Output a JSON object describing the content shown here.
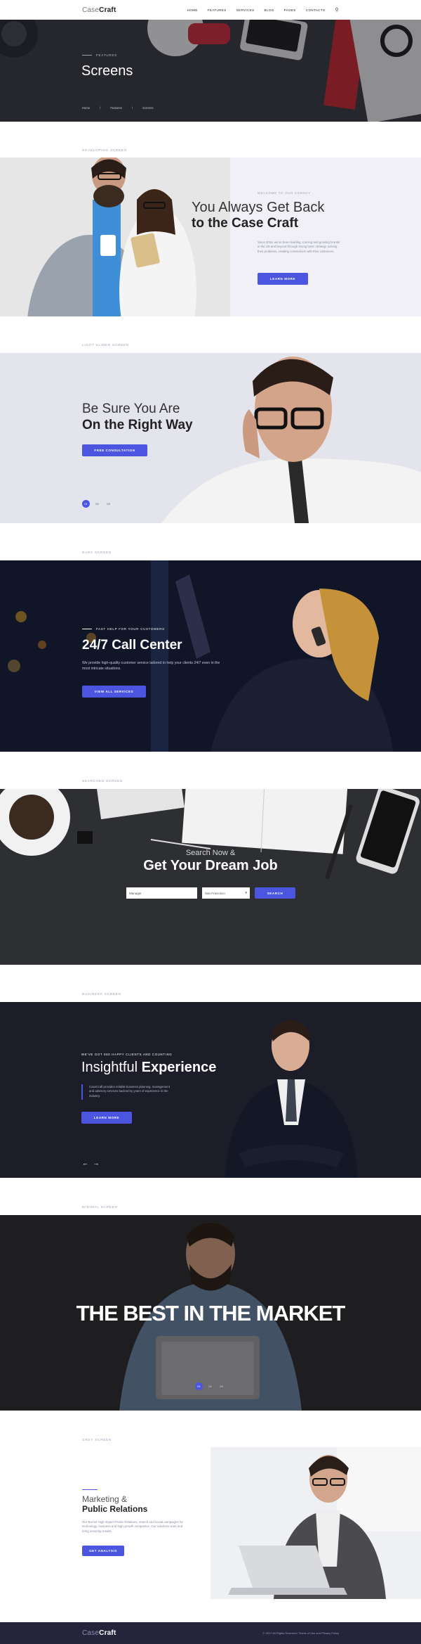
{
  "header": {
    "logo_light": "Case",
    "logo_bold": "Craft",
    "nav": [
      "Home",
      "Features",
      "Services",
      "Blog",
      "Pages",
      "Contacts"
    ]
  },
  "hero": {
    "kicker": "FEATURES",
    "title": "Screens",
    "breadcrumbs": [
      "Home",
      "Features",
      "Screens"
    ]
  },
  "s1": {
    "label": "DEVELOPING SCREEN",
    "kicker": "WELCOME TO OUR AGENCY",
    "title_light": "You Always Get Back",
    "title_bold": "to the Case Craft",
    "body": "Since 2016, we've been building, running and growing brands in the US and beyond through strong basic strategy, solving their problems, creating connections with their customers.",
    "button": "LEARN MORE"
  },
  "s2": {
    "label": "LIGHT SLIDER SCREEN",
    "title_light": "Be Sure You Are",
    "title_bold": "On the Right Way",
    "button": "FREE CONSULTATION",
    "dots": [
      "01",
      "02",
      "03"
    ]
  },
  "s3": {
    "label": "DARK SCREEN",
    "kicker": "FAST HELP FOR YOUR CUSTOMERS",
    "title": "24/7 Call Center",
    "body": "We provide high-quality customer service tailored to help your clients 24/7 even in the most intricate situations.",
    "button": "VIEW ALL SERVICES"
  },
  "s4": {
    "label": "SEARCHED SCREEN",
    "pre": "Search Now &",
    "title": "Get Your Dream Job",
    "input_value": "Manager",
    "select_value": "San Francisco",
    "button": "SEARCH"
  },
  "s5": {
    "label": "BUSINESS SCREEN",
    "kicker": "WE'VE GOT 500 HAPPY CLIENTS AND COUNTING",
    "title_light": "Insightful",
    "title_bold": "Experience",
    "body": "CaseCraft provides reliable business planning, management and advisory services backed by years of experience in the industry.",
    "button": "LEARN MORE",
    "arrows": "← →"
  },
  "s6": {
    "label": "MINIMAL SCREEN",
    "title": "THE BEST IN THE MARKET",
    "dots": [
      "01",
      "02",
      "03"
    ]
  },
  "s7": {
    "label": "GREY SCREEN",
    "title_light": "Marketing &",
    "title_bold": "Public Relations",
    "body": "Our Bernel High Impact Public Relations, search and social campaigns for technology, business and high-growth companies. Our solutions work and bring amazing results.",
    "button": "GET ANALYSIS"
  },
  "footer": {
    "logo_light": "Case",
    "logo_bold": "Craft",
    "copyright": "© 2017 All Rights Reserved. Terms of Use and Privacy Policy"
  },
  "colors": {
    "accent": "#4b55e0",
    "dark": "#24243a"
  }
}
